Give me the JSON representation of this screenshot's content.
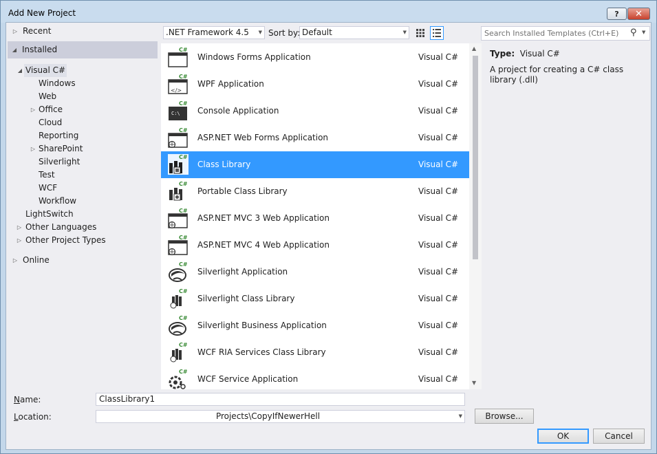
{
  "window": {
    "title": "Add New Project",
    "help_label": "?",
    "close_label": "✕"
  },
  "tree": {
    "recent": "Recent",
    "installed": "Installed",
    "visual_csharp": "Visual C#",
    "children": [
      "Windows",
      "Web",
      "Office",
      "Cloud",
      "Reporting",
      "SharePoint",
      "Silverlight",
      "Test",
      "WCF",
      "Workflow"
    ],
    "lightswitch": "LightSwitch",
    "other_languages": "Other Languages",
    "other_project_types": "Other Project Types",
    "online": "Online"
  },
  "toolbar": {
    "framework": ".NET Framework 4.5",
    "sort_label": "Sort by:",
    "sort_value": "Default"
  },
  "search": {
    "placeholder": "Search Installed Templates (Ctrl+E)"
  },
  "templates": [
    {
      "name": "Windows Forms Application",
      "lang": "Visual C#",
      "icon": "winforms-icon"
    },
    {
      "name": "WPF Application",
      "lang": "Visual C#",
      "icon": "wpf-icon"
    },
    {
      "name": "Console Application",
      "lang": "Visual C#",
      "icon": "console-icon"
    },
    {
      "name": "ASP.NET Web Forms Application",
      "lang": "Visual C#",
      "icon": "web-app-icon"
    },
    {
      "name": "Class Library",
      "lang": "Visual C#",
      "icon": "class-library-icon",
      "selected": true
    },
    {
      "name": "Portable Class Library",
      "lang": "Visual C#",
      "icon": "portable-library-icon"
    },
    {
      "name": "ASP.NET MVC 3 Web Application",
      "lang": "Visual C#",
      "icon": "web-app-icon"
    },
    {
      "name": "ASP.NET MVC 4 Web Application",
      "lang": "Visual C#",
      "icon": "web-app-icon"
    },
    {
      "name": "Silverlight Application",
      "lang": "Visual C#",
      "icon": "silverlight-icon"
    },
    {
      "name": "Silverlight Class Library",
      "lang": "Visual C#",
      "icon": "silverlight-library-icon"
    },
    {
      "name": "Silverlight Business Application",
      "lang": "Visual C#",
      "icon": "silverlight-icon"
    },
    {
      "name": "WCF RIA Services Class Library",
      "lang": "Visual C#",
      "icon": "ria-library-icon"
    },
    {
      "name": "WCF Service Application",
      "lang": "Visual C#",
      "icon": "wcf-service-icon"
    }
  ],
  "info": {
    "type_label": "Type:",
    "type_value": "Visual C#",
    "description": "A project for creating a C# class library (.dll)"
  },
  "form": {
    "name_label": "Name:",
    "name_value": "ClassLibrary1",
    "location_label": "Location:",
    "location_value": "Projects\\CopyIfNewerHell",
    "browse_label": "Browse...",
    "ok_label": "OK",
    "cancel_label": "Cancel"
  },
  "colors": {
    "selection": "#3399ff",
    "csharp_badge": "#388a34"
  }
}
